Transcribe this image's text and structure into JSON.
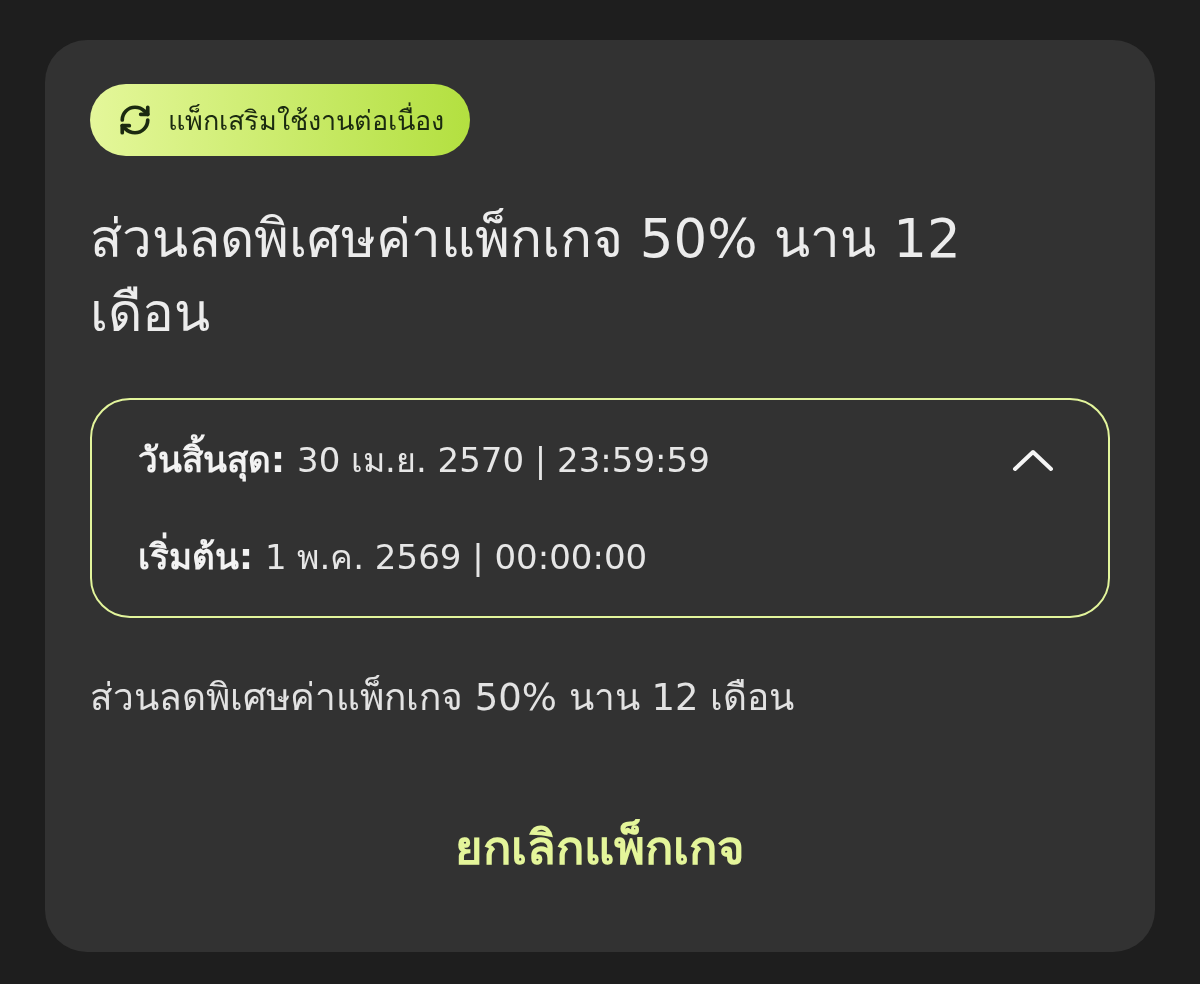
{
  "badge": {
    "label": "แพ็กเสริมใช้งานต่อเนื่อง"
  },
  "title": "ส่วนลดพิเศษค่าแพ็กเกจ 50% นาน 12 เดือน",
  "period": {
    "expanded": true,
    "rows": [
      {
        "label": "วันสิ้นสุด:",
        "value": "30 เม.ย. 2570 | 23:59:59"
      },
      {
        "label": "เริ่มต้น:",
        "value": "1 พ.ค. 2569 | 00:00:00"
      }
    ]
  },
  "description": "ส่วนลดพิเศษค่าแพ็กเกจ 50% นาน 12 เดือน",
  "action": {
    "label": "ยกเลิกแพ็กเกจ"
  }
}
